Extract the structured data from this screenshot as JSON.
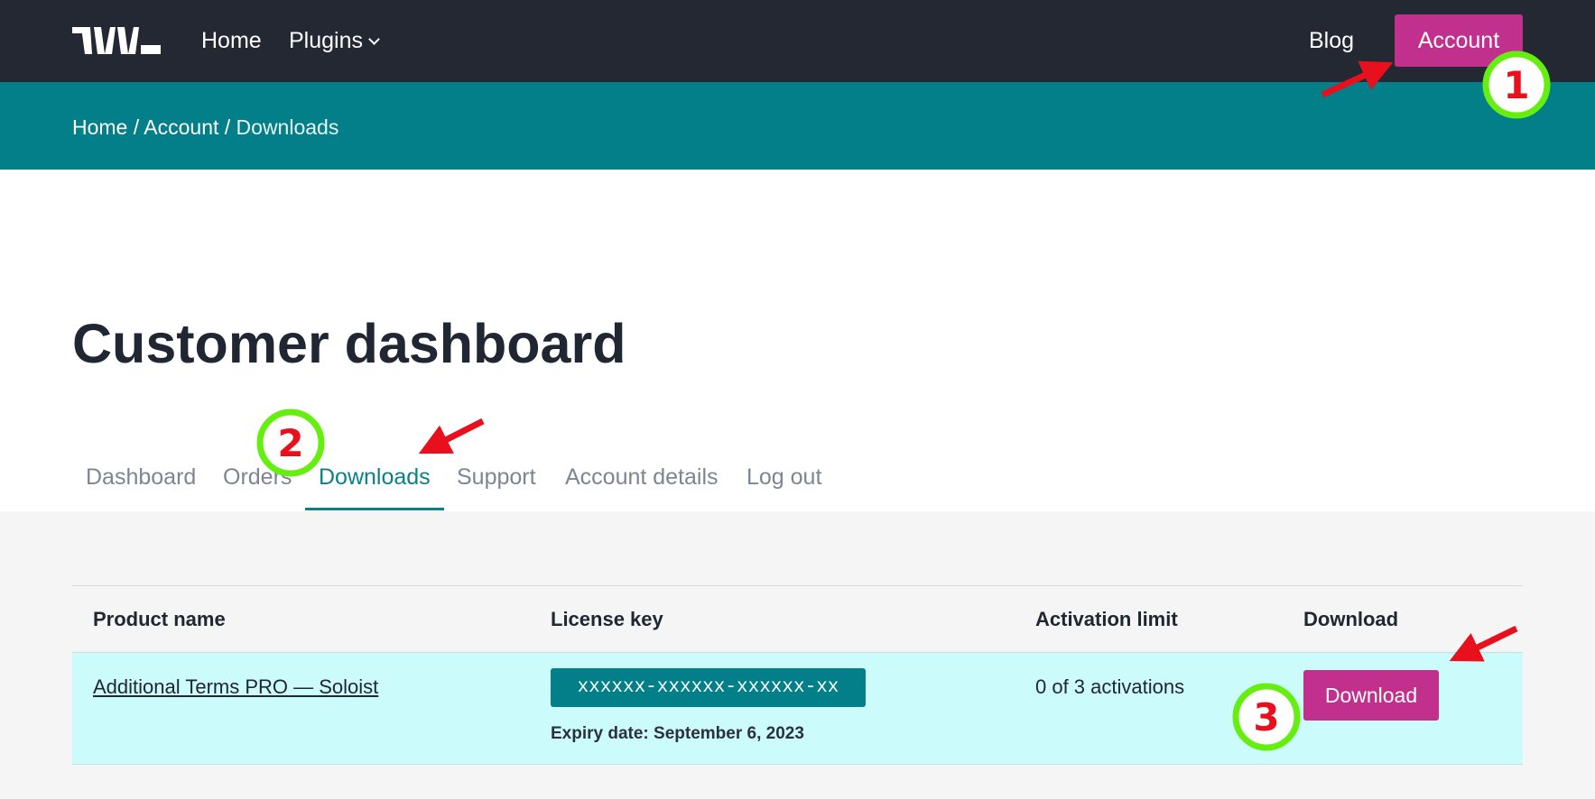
{
  "header": {
    "logo": "logo-icon",
    "nav": {
      "home": "Home",
      "plugins": "Plugins",
      "blog": "Blog"
    },
    "account_button": "Account"
  },
  "breadcrumb": {
    "home": "Home",
    "sep1": " / ",
    "account": "Account",
    "sep2": " / ",
    "current": "Downloads"
  },
  "page": {
    "title": "Customer dashboard"
  },
  "tabs": [
    {
      "label": "Dashboard"
    },
    {
      "label": "Orders"
    },
    {
      "label": "Downloads",
      "active": true
    },
    {
      "label": "Support"
    },
    {
      "label": "Account details"
    },
    {
      "label": "Log out"
    }
  ],
  "table": {
    "headers": {
      "product": "Product name",
      "license": "License key",
      "limit": "Activation limit",
      "download": "Download"
    },
    "rows": [
      {
        "product": "Additional Terms PRO — Soloist",
        "license_key": "xxxxxx-xxxxxx-xxxxxx-xx",
        "expiry": "Expiry date: September 6, 2023",
        "activations": "0 of 3 activations",
        "download_label": "Download"
      }
    ]
  },
  "annotations": {
    "step_1": "1",
    "step_2": "2",
    "step_3": "3",
    "marker_color": "#e8101d",
    "ring_color": "#66ee11"
  },
  "colors": {
    "nav_bg": "#232833",
    "teal": "#027f88",
    "accent_magenta": "#c2308d",
    "row_highlight": "#ccfbfb"
  }
}
